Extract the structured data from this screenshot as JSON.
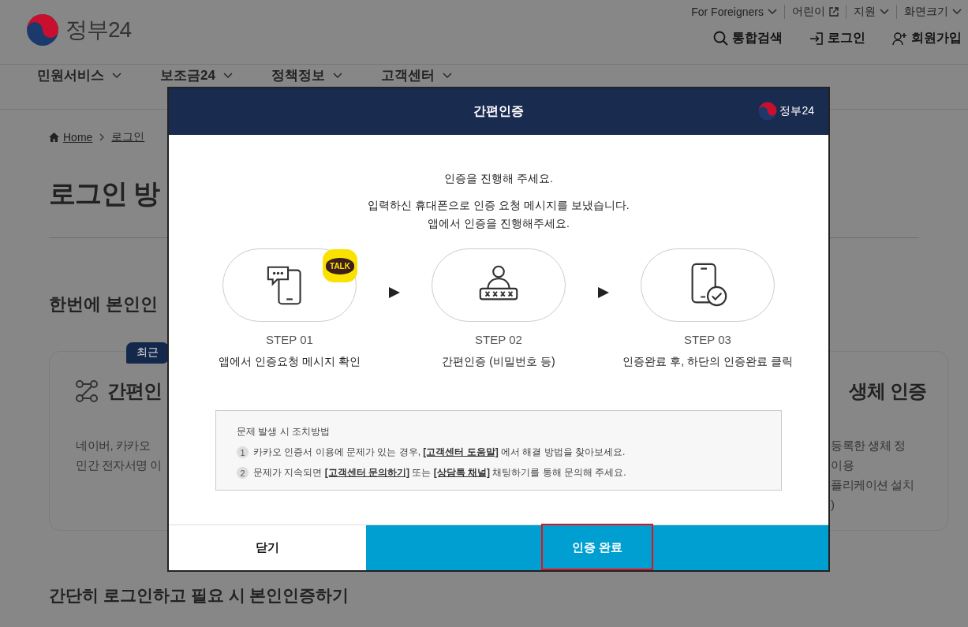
{
  "header": {
    "logo_text": "정부24",
    "top_links": [
      {
        "label": "For Foreigners",
        "kind": "menu"
      },
      {
        "label": "어린이",
        "kind": "external"
      },
      {
        "label": "지원",
        "kind": "menu"
      },
      {
        "label": "화면크기",
        "kind": "menu"
      }
    ],
    "actions": [
      {
        "label": "통합검색"
      },
      {
        "label": "로그인"
      },
      {
        "label": "회원가입"
      }
    ]
  },
  "nav": [
    {
      "label": "민원서비스"
    },
    {
      "label": "보조금24"
    },
    {
      "label": "정책정보"
    },
    {
      "label": "고객센터"
    }
  ],
  "breadcrumb": [
    "Home",
    "로그인"
  ],
  "page_title": "로그인 방",
  "section_heading": "한번에 본인인",
  "cards": [
    {
      "kind": "left",
      "badge": "최근",
      "title": "간편인",
      "lines": [
        "네이버, 카카오",
        "민간 전자서명 이"
      ]
    },
    {
      "kind": "right",
      "title": "생체 인증",
      "lines": [
        "등록한 생체 정",
        "이용",
        "플리케이션 설치",
        ")"
      ]
    }
  ],
  "bottom_heading": "간단히 로그인하고 필요 시 본인인증하기",
  "modal": {
    "title": "간편인증",
    "logo_text": "정부24",
    "intro": "인증을 진행해 주세요.",
    "message": [
      "입력하신 휴대폰으로 인증 요청 메시지를 보냈습니다.",
      "앱에서 인증을 진행해주세요."
    ],
    "steps": [
      {
        "badge": "TALK",
        "label": "STEP 01",
        "desc": "앱에서 인증요청 메시지 확인"
      },
      {
        "label": "STEP 02",
        "desc": "간편인증 (비밀번호 등)"
      },
      {
        "label": "STEP 03",
        "desc": "인증완료 후, 하단의 인증완료 클릭"
      }
    ],
    "help": {
      "title": "문제 발생 시 조치방법",
      "items": [
        {
          "number": "1",
          "parts": [
            {
              "kind": "text",
              "text": "카카오 인증서 이용에 문제가 있는 경우, "
            },
            {
              "kind": "link",
              "text": "[고객센터 도움말]"
            },
            {
              "kind": "text",
              "text": " 에서 해결 방법을 찾아보세요."
            }
          ]
        },
        {
          "number": "2",
          "parts": [
            {
              "kind": "text",
              "text": "문제가 지속되면 "
            },
            {
              "kind": "link",
              "text": "[고객센터 문의하기]"
            },
            {
              "kind": "text",
              "text": " 또는 "
            },
            {
              "kind": "link",
              "text": "[상담톡 채널]"
            },
            {
              "kind": "text",
              "text": " 채팅하기를 통해 문의해 주세요."
            }
          ]
        }
      ]
    },
    "buttons": [
      {
        "label": "닫기",
        "kind": "secondary",
        "highlighted": false
      },
      {
        "label": "인증 완료",
        "kind": "primary",
        "highlighted": true
      }
    ]
  }
}
